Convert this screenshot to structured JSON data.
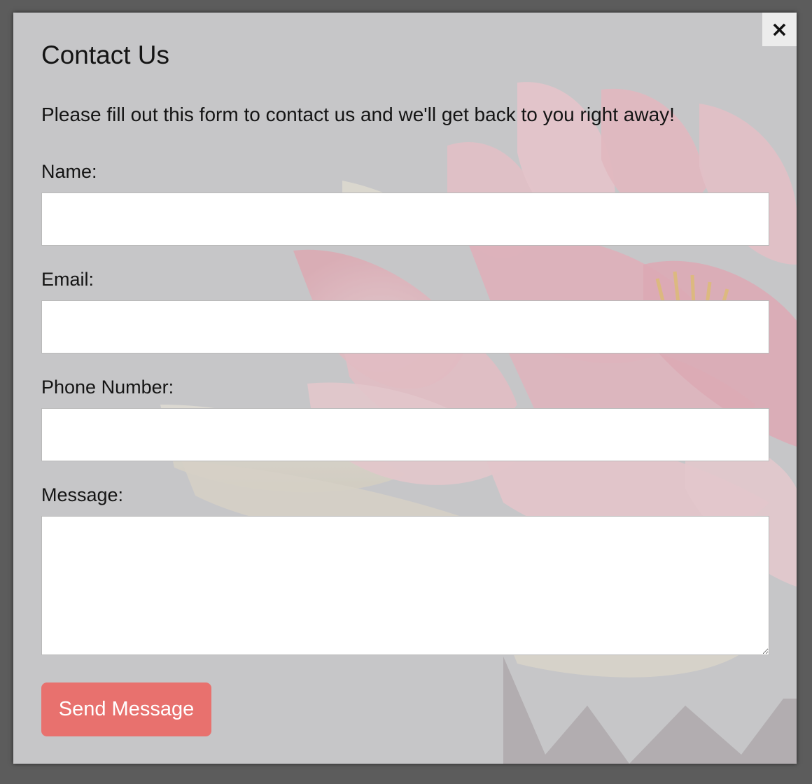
{
  "modal": {
    "title": "Contact Us",
    "intro": "Please fill out this form to contact us and we'll get back to you right away!",
    "close_label": "×"
  },
  "form": {
    "name_label": "Name:",
    "name_value": "",
    "email_label": "Email:",
    "email_value": "",
    "phone_label": "Phone Number:",
    "phone_value": "",
    "message_label": "Message:",
    "message_value": "",
    "submit_label": "Send Message"
  },
  "colors": {
    "overlay": "#5c5c5c",
    "modal_background": "#c7c7c9",
    "accent_button": "#e8716e",
    "button_text": "#ffffff"
  },
  "icons": {
    "close": "close-icon",
    "resize_handle": "resize-grip-icon"
  }
}
